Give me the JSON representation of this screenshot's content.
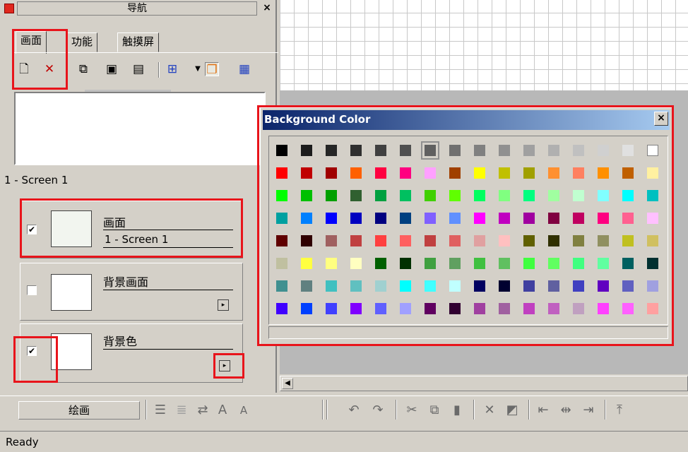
{
  "nav": {
    "title": "导航",
    "close": "×",
    "tabs": [
      "画面",
      "功能",
      "触摸屏"
    ],
    "screen_label": "1 - Screen 1",
    "layers": [
      {
        "name": "画面",
        "sub": "1 - Screen 1",
        "checked": true
      },
      {
        "name": "背景画面",
        "sub": "",
        "checked": false
      },
      {
        "name": "背景色",
        "sub": "",
        "checked": true
      }
    ],
    "check_mark": "✔",
    "arrow": "▸"
  },
  "bottom": {
    "draw_button": "绘画",
    "status": "Ready"
  },
  "dialog": {
    "title": "Background Color",
    "close": "×",
    "selected_index": 6,
    "rows": [
      [
        "#000000",
        "#1c1c1c",
        "#262626",
        "#303030",
        "#404040",
        "#505050",
        "#606060",
        "#707070",
        "#808080",
        "#909090",
        "#a0a0a0",
        "#b0b0b0",
        "#c0c0c0",
        "#d0d0d0",
        "#e0e0e0",
        "#ffffff"
      ],
      [
        "#ff0000",
        "#c00000",
        "#a00000",
        "#ff6000",
        "#ff0040",
        "#ff0080",
        "#ffa0ff",
        "#a04000",
        "#ffff00",
        "#c0c000",
        "#a0a000",
        "#ff9030",
        "#ff8060",
        "#ff9000",
        "#c06000",
        "#fff0a0"
      ],
      [
        "#00ff00",
        "#00c000",
        "#00a000",
        "#306030",
        "#00a040",
        "#00c060",
        "#40d000",
        "#60ff00",
        "#00ff60",
        "#80ff80",
        "#00ff80",
        "#a0ffa0",
        "#c0ffd0",
        "#80ffff",
        "#00ffff",
        "#00c0c0"
      ],
      [
        "#00a0a0",
        "#0080ff",
        "#0000ff",
        "#0000c0",
        "#000080",
        "#004080",
        "#8060ff",
        "#6090ff",
        "#ff00ff",
        "#c000c0",
        "#a000a0",
        "#800040",
        "#c00060",
        "#ff0080",
        "#ff6090",
        "#ffc0ff"
      ],
      [
        "#600000",
        "#300000",
        "#a06060",
        "#c04040",
        "#ff4040",
        "#ff6060",
        "#c04040",
        "#e06060",
        "#e0a0a0",
        "#ffc0c0",
        "#606000",
        "#303000",
        "#808040",
        "#909060",
        "#c0c020",
        "#d0c060"
      ],
      [
        "#c0c0a0",
        "#ffff40",
        "#ffff80",
        "#ffffc0",
        "#006000",
        "#003000",
        "#40a040",
        "#60a060",
        "#40c040",
        "#60c060",
        "#40ff40",
        "#60ff60",
        "#40ff80",
        "#60ffa0",
        "#006060",
        "#003030"
      ],
      [
        "#409090",
        "#608080",
        "#40c0c0",
        "#60c0c0",
        "#a0d0d0",
        "#00ffff",
        "#40ffff",
        "#c0ffff",
        "#000060",
        "#000030",
        "#4040a0",
        "#6060a0",
        "#4040c0",
        "#6000c0",
        "#6060c0",
        "#a0a0e0"
      ],
      [
        "#4000ff",
        "#0040ff",
        "#4040ff",
        "#8000ff",
        "#6060ff",
        "#a0a0ff",
        "#600060",
        "#300030",
        "#a040a0",
        "#a060a0",
        "#c040c0",
        "#c060c0",
        "#c0a0c0",
        "#ff40ff",
        "#ff60ff",
        "#ffa0a0"
      ]
    ]
  }
}
